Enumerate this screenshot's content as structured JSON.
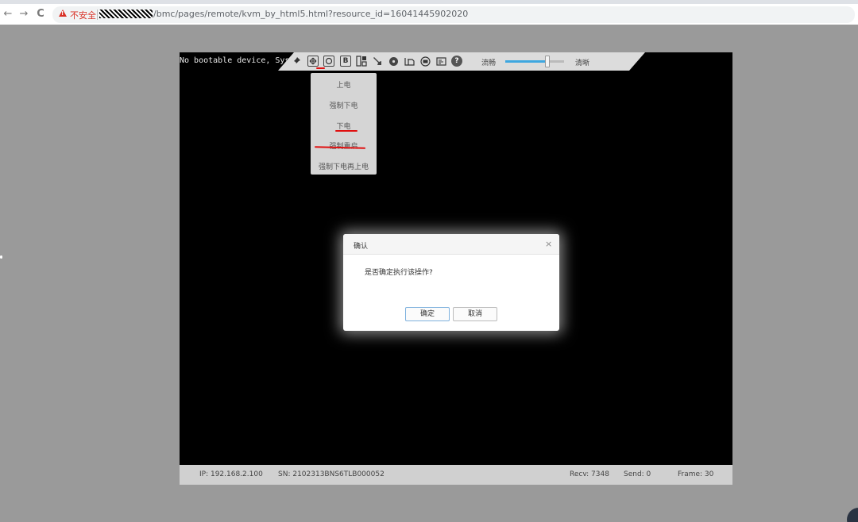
{
  "browser": {
    "back": "←",
    "forward": "→",
    "reload": "C",
    "security_label": "不安全",
    "url": "/bmc/pages/remote/kvm_by_html5.html?resource_id=16041445902020"
  },
  "console": {
    "text": "No bootable device, Sys"
  },
  "toolbar": {
    "icons": [
      "pin-icon",
      "fullscreen-icon",
      "power-icon",
      "boot-b-icon",
      "keyboard-icon",
      "mouse-icon",
      "disc-icon",
      "record-icon",
      "video-icon",
      "screenshot-icon",
      "help-icon"
    ],
    "left_label": "流畅",
    "right_label": "清晰",
    "slider_value": 0.72,
    "help_glyph": "?",
    "boot_glyph": "B"
  },
  "power_menu": {
    "items": [
      "上电",
      "强制下电",
      "下电",
      "强制重启",
      "强制下电再上电"
    ]
  },
  "status": {
    "ip": "IP: 192.168.2.100",
    "sn": "SN: 2102313BNS6TLB000052",
    "recv": "Recv: 7348",
    "send": "Send: 0",
    "frame": "Frame: 30"
  },
  "dialog": {
    "title": "确认",
    "close": "×",
    "message": "是否确定执行该操作?",
    "confirm_label": "确定",
    "cancel_label": "取消"
  },
  "colors": {
    "annotation": "#e01010",
    "slider_accent": "#3ea7e0",
    "security_warning": "#d93025"
  }
}
